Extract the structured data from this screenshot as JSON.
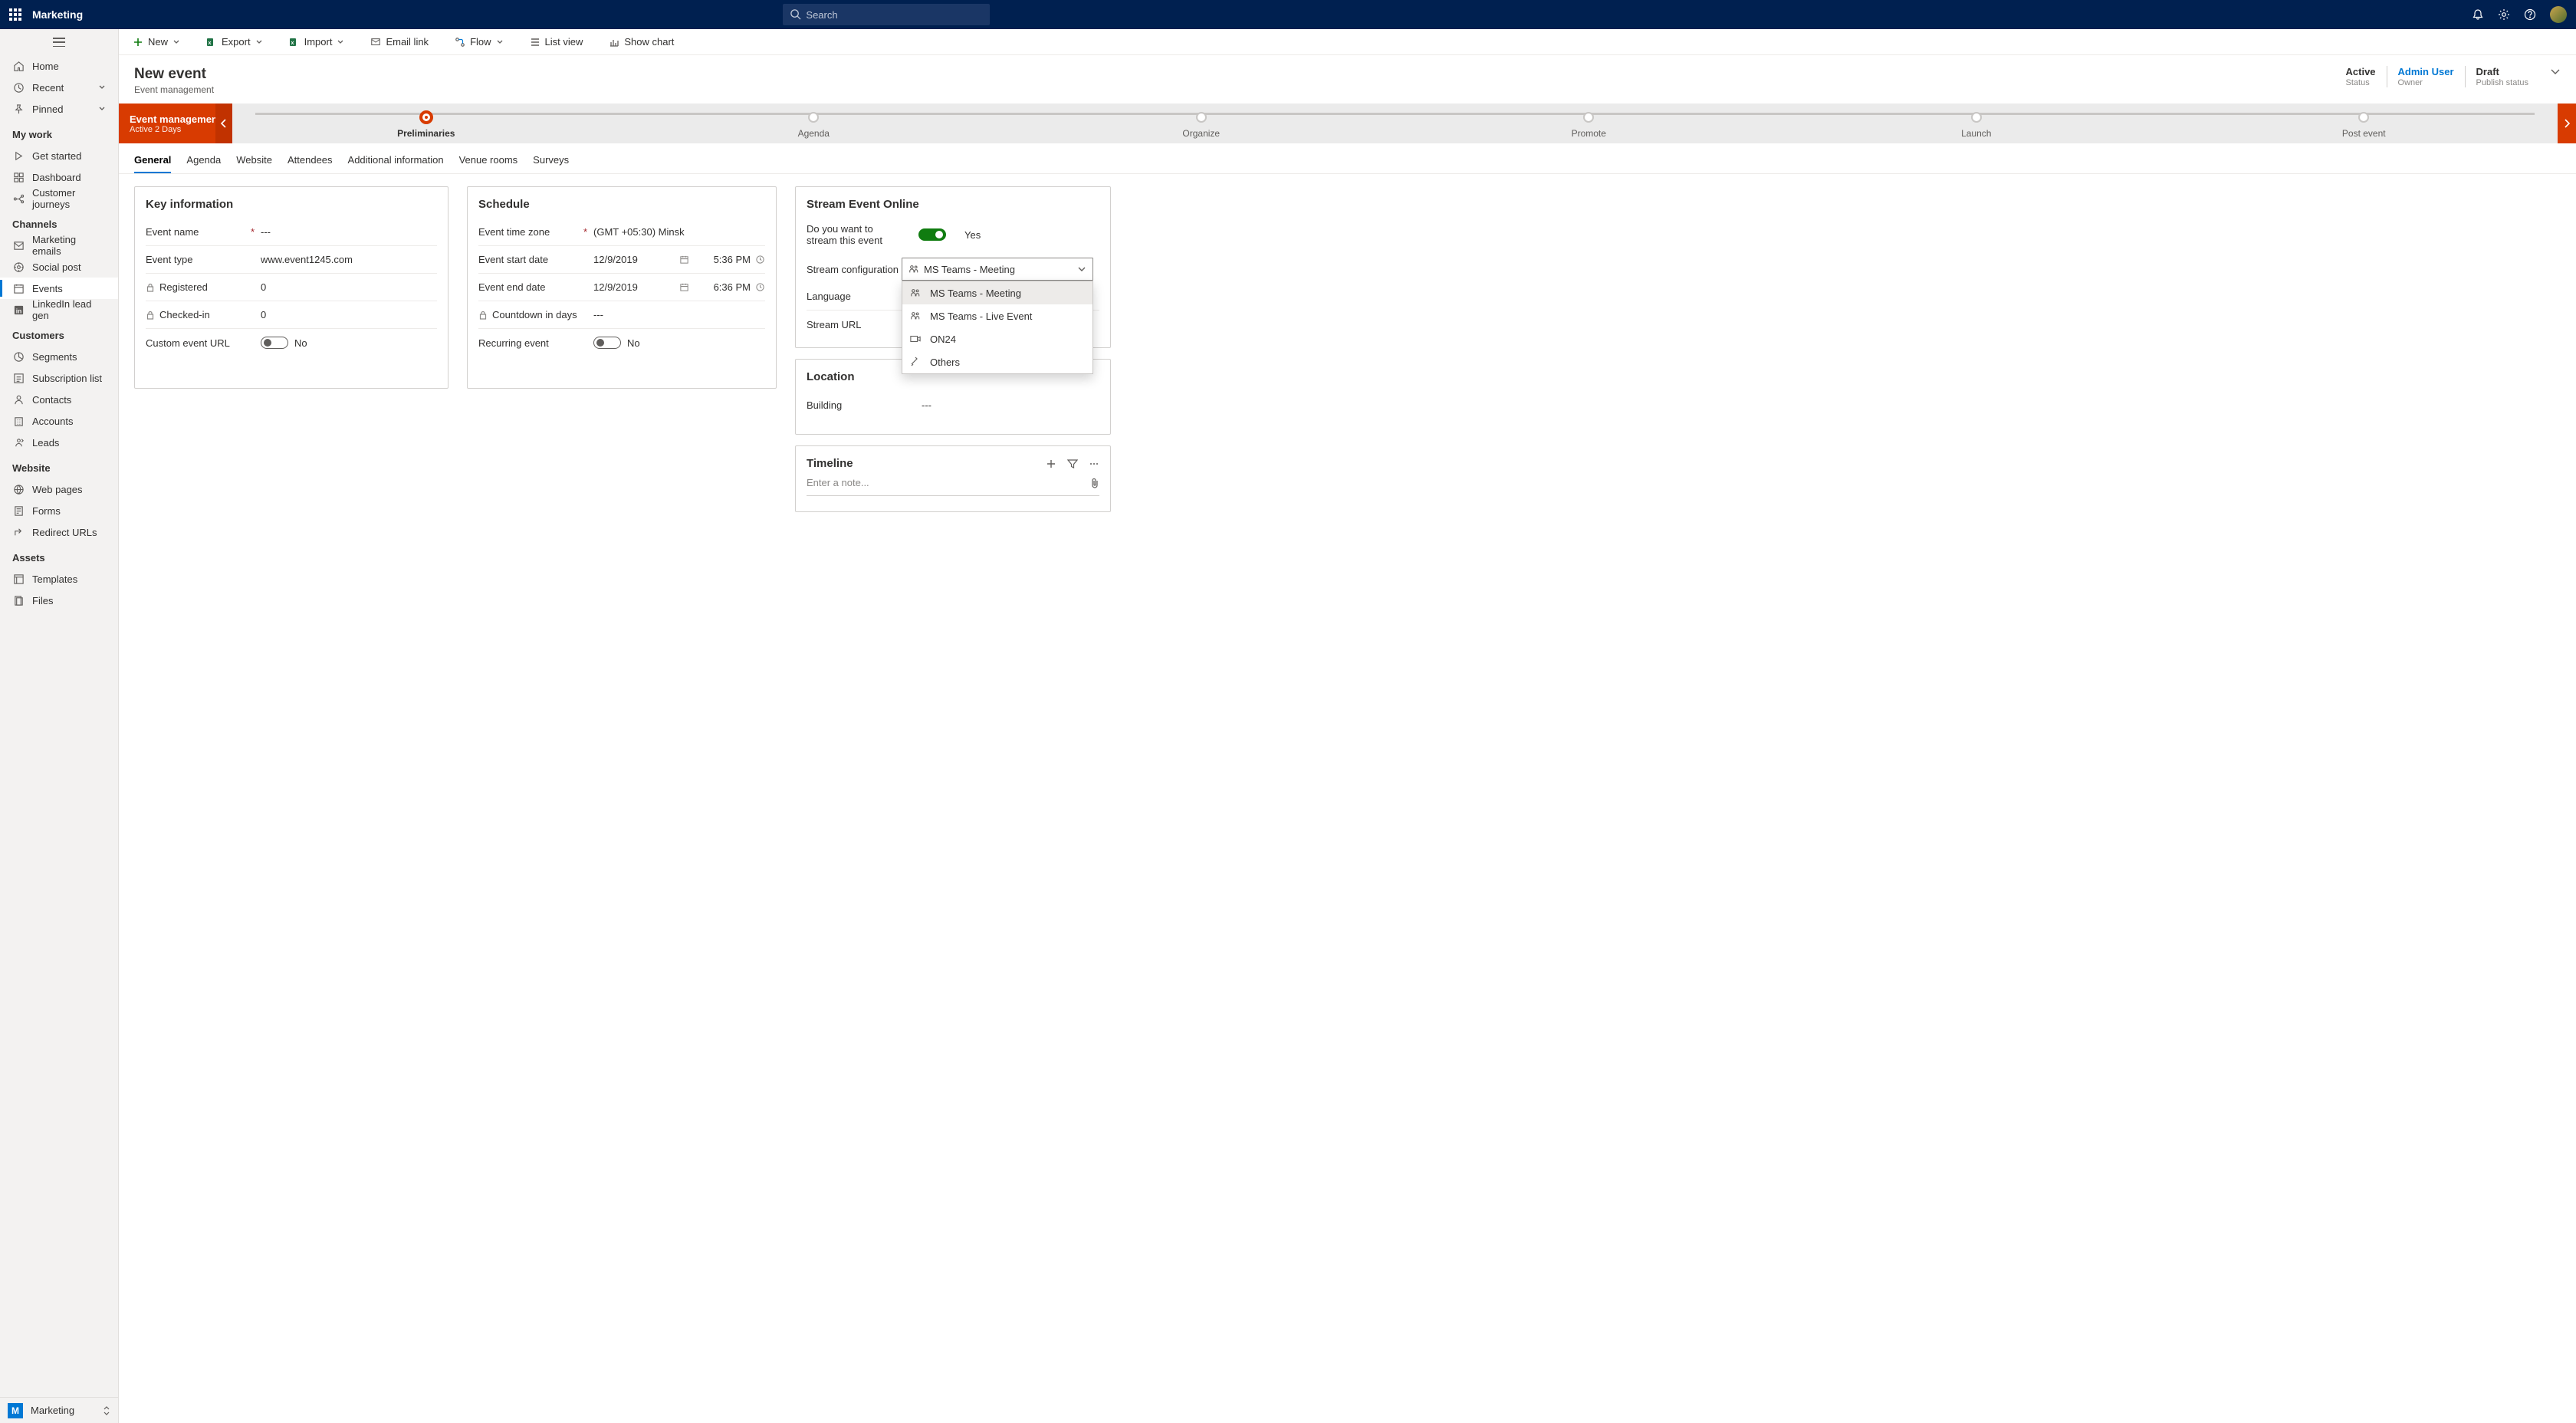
{
  "app_name": "Marketing",
  "search_placeholder": "Search",
  "top_actions": {
    "notifications": "notifications",
    "settings": "settings",
    "help": "help"
  },
  "commandbar": [
    {
      "id": "new",
      "label": "New",
      "dd": true
    },
    {
      "id": "export",
      "label": "Export",
      "dd": true
    },
    {
      "id": "import",
      "label": "Import",
      "dd": true
    },
    {
      "id": "emaillink",
      "label": "Email link"
    },
    {
      "id": "flow",
      "label": "Flow",
      "dd": true
    },
    {
      "id": "listview",
      "label": "List view"
    },
    {
      "id": "showchart",
      "label": "Show chart"
    }
  ],
  "nav": {
    "top": [
      {
        "id": "home",
        "label": "Home"
      },
      {
        "id": "recent",
        "label": "Recent",
        "chev": true
      },
      {
        "id": "pinned",
        "label": "Pinned",
        "chev": true
      }
    ],
    "sections": [
      {
        "title": "My work",
        "items": [
          {
            "id": "getstarted",
            "label": "Get started"
          },
          {
            "id": "dashboard",
            "label": "Dashboard"
          },
          {
            "id": "journeys",
            "label": "Customer journeys"
          }
        ]
      },
      {
        "title": "Channels",
        "items": [
          {
            "id": "memails",
            "label": "Marketing emails"
          },
          {
            "id": "social",
            "label": "Social post"
          },
          {
            "id": "events",
            "label": "Events",
            "selected": true
          },
          {
            "id": "linkedin",
            "label": "LinkedIn lead gen"
          }
        ]
      },
      {
        "title": "Customers",
        "items": [
          {
            "id": "segments",
            "label": "Segments"
          },
          {
            "id": "sublist",
            "label": "Subscription list"
          },
          {
            "id": "contacts",
            "label": "Contacts"
          },
          {
            "id": "accounts",
            "label": "Accounts"
          },
          {
            "id": "leads",
            "label": "Leads"
          }
        ]
      },
      {
        "title": "Website",
        "items": [
          {
            "id": "webpages",
            "label": "Web pages"
          },
          {
            "id": "forms",
            "label": "Forms"
          },
          {
            "id": "redirect",
            "label": "Redirect URLs"
          }
        ]
      },
      {
        "title": "Assets",
        "items": [
          {
            "id": "templates",
            "label": "Templates"
          },
          {
            "id": "files",
            "label": "Files"
          }
        ]
      }
    ],
    "footer": {
      "initial": "M",
      "label": "Marketing"
    }
  },
  "header": {
    "title": "New event",
    "subtitle": "Event management",
    "meta": [
      {
        "value": "Active",
        "label": "Status"
      },
      {
        "value": "Admin User",
        "label": "Owner",
        "link": true
      },
      {
        "value": "Draft",
        "label": "Publish status"
      }
    ]
  },
  "process": {
    "stage_title": "Event management",
    "stage_sub": "Active 2 Days",
    "steps": [
      "Preliminaries",
      "Agenda",
      "Organize",
      "Promote",
      "Launch",
      "Post event"
    ],
    "active_index": 0
  },
  "tabs": [
    "General",
    "Agenda",
    "Website",
    "Attendees",
    "Additional information",
    "Venue rooms",
    "Surveys"
  ],
  "active_tab": 0,
  "key_info": {
    "title": "Key information",
    "rows": [
      {
        "label": "Event name",
        "req": true,
        "value": "---"
      },
      {
        "label": "Event type",
        "value": "www.event1245.com"
      },
      {
        "label": "Registered",
        "lock": true,
        "value": "0"
      },
      {
        "label": "Checked-in",
        "lock": true,
        "value": "0"
      },
      {
        "label": "Custom event URL",
        "toggle": false,
        "value": "No"
      }
    ]
  },
  "schedule": {
    "title": "Schedule",
    "rows": [
      {
        "label": "Event time zone",
        "req": true,
        "value": "(GMT +05:30) Minsk"
      },
      {
        "label": "Event start date",
        "value": "12/9/2019",
        "time": "5:36 PM"
      },
      {
        "label": "Event end date",
        "value": "12/9/2019",
        "time": "6:36 PM"
      },
      {
        "label": "Countdown in days",
        "lock": true,
        "value": "---"
      },
      {
        "label": "Recurring event",
        "toggle": false,
        "value": "No"
      }
    ]
  },
  "stream": {
    "title": "Stream Event Online",
    "question": "Do you want to stream this event",
    "answer": "Yes",
    "config_label": "Stream configuration",
    "config_value": "MS Teams - Meeting",
    "options": [
      "MS Teams - Meeting",
      "MS Teams - Live Event",
      "ON24",
      "Others"
    ],
    "rows": [
      {
        "label": "Language",
        "value": ""
      },
      {
        "label": "Stream URL",
        "value": ""
      }
    ]
  },
  "location": {
    "title": "Location",
    "rows": [
      {
        "label": "Building",
        "value": "---"
      }
    ]
  },
  "timeline": {
    "title": "Timeline",
    "placeholder": "Enter a note..."
  }
}
